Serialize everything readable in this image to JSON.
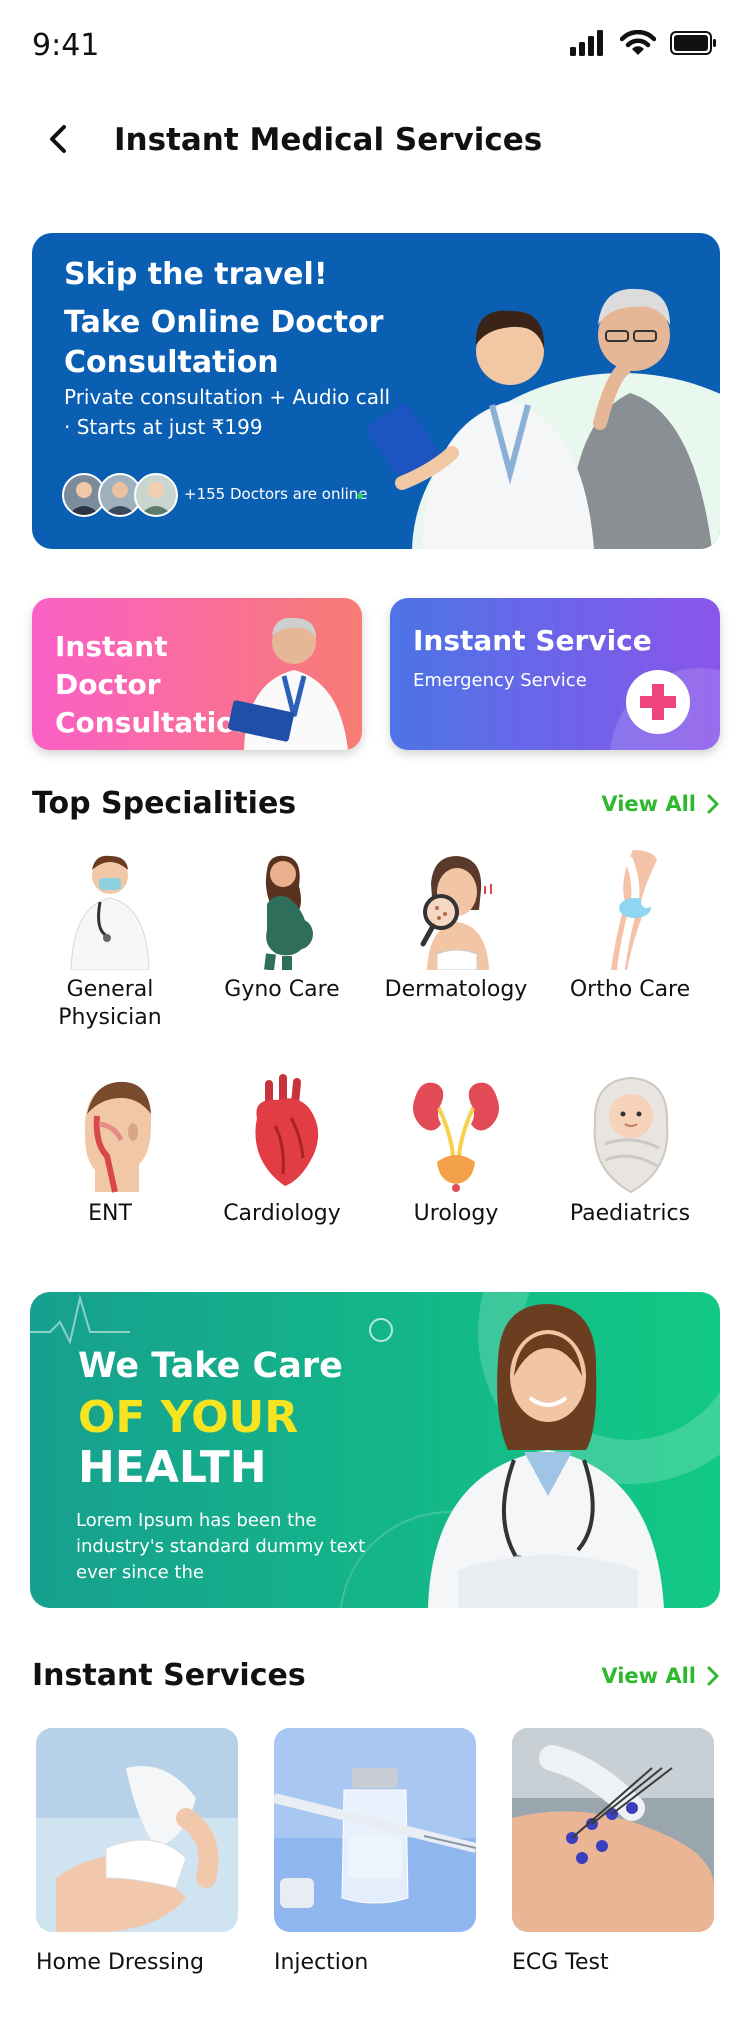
{
  "status": {
    "time": "9:41"
  },
  "header": {
    "title": "Instant Medical Services"
  },
  "hero": {
    "headline": "Skip the travel!",
    "title": "Take Online Doctor Consultation",
    "line1": "Private consultation + Audio call",
    "line2": "· Starts at just ₹199",
    "online_text": "+155 Doctors are online"
  },
  "cards": {
    "doctor": {
      "title": "Instant Doctor Consultation"
    },
    "service": {
      "title": "Instant Service",
      "subtitle": "Emergency Service"
    }
  },
  "specialities": {
    "title": "Top Specialities",
    "view_all": "View All",
    "items": [
      {
        "label": "General Physician",
        "icon": "doctor-icon"
      },
      {
        "label": "Gyno Care",
        "icon": "pregnant-woman-icon"
      },
      {
        "label": "Dermatology",
        "icon": "skin-magnifier-icon"
      },
      {
        "label": "Ortho Care",
        "icon": "knee-joint-icon"
      },
      {
        "label": "ENT",
        "icon": "ent-head-icon"
      },
      {
        "label": "Cardiology",
        "icon": "heart-icon"
      },
      {
        "label": "Urology",
        "icon": "kidney-icon"
      },
      {
        "label": "Paediatrics",
        "icon": "baby-icon"
      }
    ]
  },
  "banner": {
    "line1": "We Take Care",
    "line2": "OF YOUR",
    "line3": "HEALTH",
    "body": "Lorem Ipsum has been the industry's standard dummy text ever since the"
  },
  "services": {
    "title": "Instant Services",
    "view_all": "View All",
    "items": [
      {
        "label": "Home Dressing"
      },
      {
        "label": "Injection"
      },
      {
        "label": "ECG Test"
      }
    ]
  },
  "colors": {
    "primary_blue": "#0a5fb3",
    "accent_green": "#2eb82e",
    "banner_green": "#12c984"
  }
}
